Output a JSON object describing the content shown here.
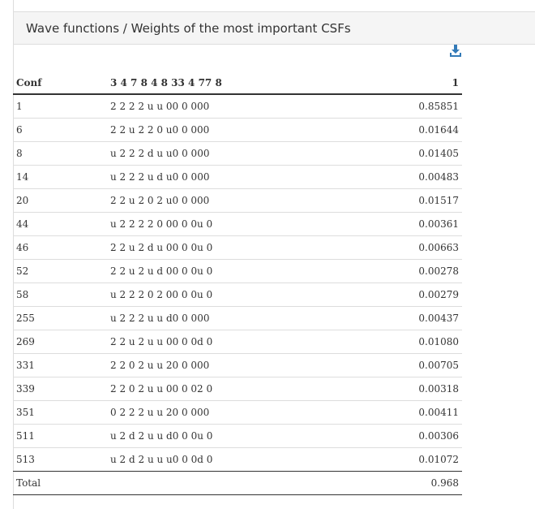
{
  "panel": {
    "title": "Wave functions / Weights of the most important CSFs"
  },
  "icons": {
    "download": "download-icon"
  },
  "colors": {
    "icon_blue": "#337ab7",
    "heading_bg": "#f5f5f5",
    "border": "#dddddd"
  },
  "table": {
    "headers": [
      "Conf",
      "3 4 7 8 4 8 33 4 77 8",
      "1"
    ],
    "rows": [
      [
        "1",
        "2 2 2 2 u u 00 0 000",
        "0.85851"
      ],
      [
        "6",
        "2 2 u 2 2 0 u0 0 000",
        "0.01644"
      ],
      [
        "8",
        "u 2 2 2 d u u0 0 000",
        "0.01405"
      ],
      [
        "14",
        "u 2 2 2 u d u0 0 000",
        "0.00483"
      ],
      [
        "20",
        "2 2 u 2 0 2 u0 0 000",
        "0.01517"
      ],
      [
        "44",
        "u 2 2 2 2 0 00 0 0u 0",
        "0.00361"
      ],
      [
        "46",
        "2 2 u 2 d u 00 0 0u 0",
        "0.00663"
      ],
      [
        "52",
        "2 2 u 2 u d 00 0 0u 0",
        "0.00278"
      ],
      [
        "58",
        "u 2 2 2 0 2 00 0 0u 0",
        "0.00279"
      ],
      [
        "255",
        "u 2 2 2 u u d0 0 000",
        "0.00437"
      ],
      [
        "269",
        "2 2 u 2 u u 00 0 0d 0",
        "0.01080"
      ],
      [
        "331",
        "2 2 0 2 u u 20 0 000",
        "0.00705"
      ],
      [
        "339",
        "2 2 0 2 u u 00 0 02 0",
        "0.00318"
      ],
      [
        "351",
        "0 2 2 2 u u 20 0 000",
        "0.00411"
      ],
      [
        "511",
        "u 2 d 2 u u d0 0 0u 0",
        "0.00306"
      ],
      [
        "513",
        "u 2 d 2 u u u0 0 0d 0",
        "0.01072"
      ]
    ],
    "total": {
      "label": "Total",
      "value": "0.968"
    }
  }
}
